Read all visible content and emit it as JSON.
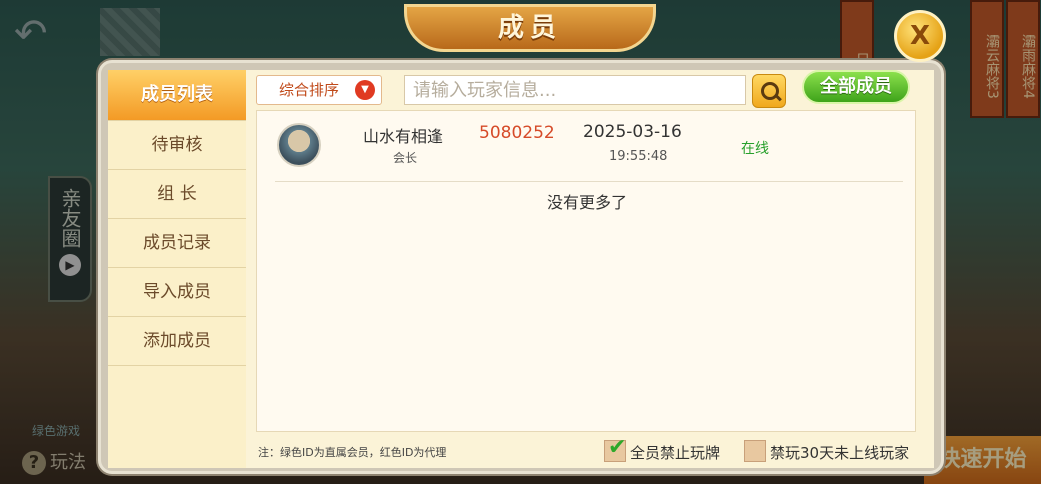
{
  "background": {
    "banners": [
      "只看",
      "灞云麻将3",
      "灞雨麻将4"
    ],
    "side_tab": "亲友圈",
    "help_label": "玩法",
    "game_label": "绿色游戏",
    "quick_start": "快速开始"
  },
  "dialog": {
    "title": "成员",
    "close_label": "X"
  },
  "sidebar": {
    "items": [
      {
        "label": "成员列表",
        "active": true
      },
      {
        "label": "待审核"
      },
      {
        "label": "组  长"
      },
      {
        "label": "成员记录"
      },
      {
        "label": "导入成员"
      },
      {
        "label": "添加成员"
      }
    ]
  },
  "toolbar": {
    "sort_label": "综合排序",
    "search_placeholder": "请输入玩家信息...",
    "all_members_label": "全部成员"
  },
  "members": [
    {
      "name": "山水有相逢",
      "role": "会长",
      "id": "5080252",
      "date": "2025-03-16",
      "time": "19:55:48",
      "status": "在线"
    }
  ],
  "list_end_text": "没有更多了",
  "footer": {
    "note": "注：绿色ID为直属会员，红色ID为代理",
    "check1_label": "全员禁止玩牌",
    "check1_checked": true,
    "check2_label": "禁玩30天未上线玩家",
    "check2_checked": false
  },
  "colors": {
    "accent": "#f39a25",
    "online": "#28a02c",
    "agent_id": "#d64a28"
  }
}
